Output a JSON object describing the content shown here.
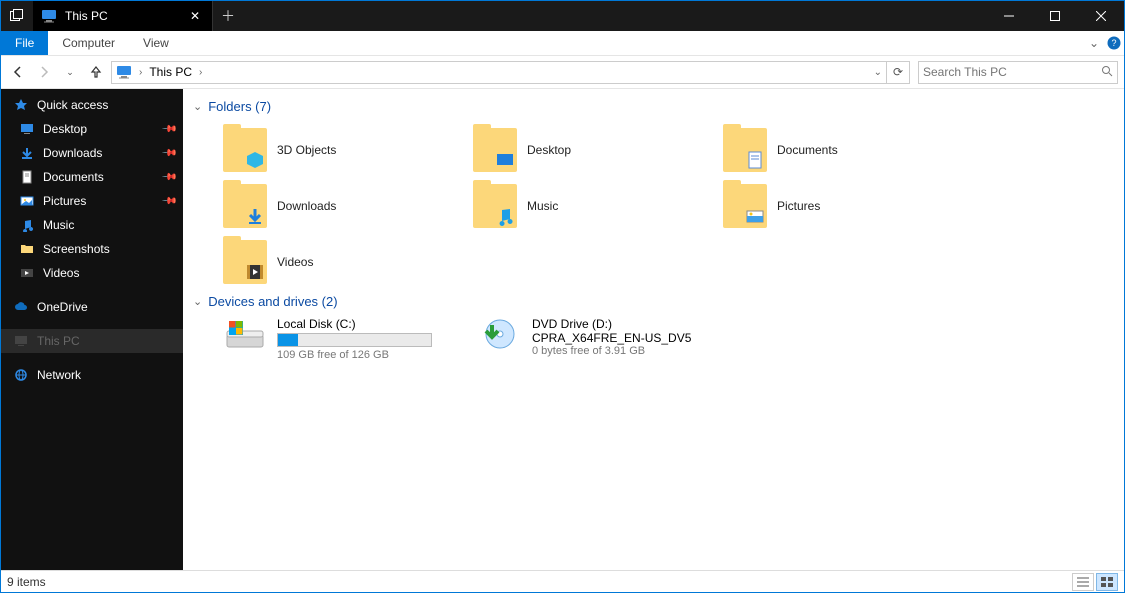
{
  "window": {
    "title": "This PC"
  },
  "menu": {
    "file": "File",
    "computer": "Computer",
    "view": "View"
  },
  "address": {
    "location": "This PC",
    "search_placeholder": "Search This PC"
  },
  "sidebar": {
    "quick": "Quick access",
    "quick_items": [
      {
        "label": "Desktop",
        "pinned": true
      },
      {
        "label": "Downloads",
        "pinned": true
      },
      {
        "label": "Documents",
        "pinned": true
      },
      {
        "label": "Pictures",
        "pinned": true
      },
      {
        "label": "Music",
        "pinned": false
      },
      {
        "label": "Screenshots",
        "pinned": false
      },
      {
        "label": "Videos",
        "pinned": false
      }
    ],
    "onedrive": "OneDrive",
    "thispc": "This PC",
    "network": "Network"
  },
  "groups": {
    "folders_header": "Folders (7)",
    "folders": [
      {
        "label": "3D Objects"
      },
      {
        "label": "Desktop"
      },
      {
        "label": "Documents"
      },
      {
        "label": "Downloads"
      },
      {
        "label": "Music"
      },
      {
        "label": "Pictures"
      },
      {
        "label": "Videos"
      }
    ],
    "drives_header": "Devices and drives (2)",
    "drives": [
      {
        "label": "Local Disk (C:)",
        "free_text": "109 GB free of 126 GB",
        "used_pct": 13
      },
      {
        "label": "DVD Drive (D:)",
        "sub_label": "CPRA_X64FRE_EN-US_DV5",
        "free_text": "0 bytes free of 3.91 GB"
      }
    ]
  },
  "status": {
    "text": "9 items"
  }
}
